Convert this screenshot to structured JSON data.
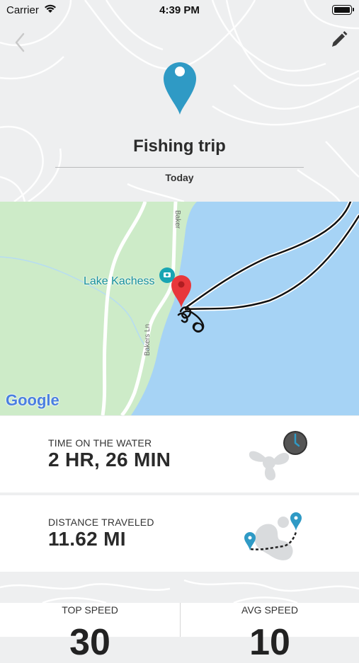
{
  "status_bar": {
    "carrier": "Carrier",
    "time": "4:39 PM"
  },
  "header": {
    "title": "Fishing trip",
    "date": "Today"
  },
  "map": {
    "place_label": "Lake Kachess",
    "road_label_1": "Baker",
    "road_label_2": "Bakers Ln",
    "attribution": "Google",
    "colors": {
      "land": "#cdebc8",
      "water": "#a6d3f5",
      "track": "#111111",
      "pin": "#e8373b"
    }
  },
  "stats": [
    {
      "label": "TIME ON THE WATER",
      "value": "2 HR, 26 MIN",
      "icon": "propeller-clock-icon"
    },
    {
      "label": "DISTANCE TRAVELED",
      "value": "11.62 MI",
      "icon": "route-map-icon"
    }
  ],
  "speeds": {
    "top": {
      "label": "TOP SPEED",
      "value": "30"
    },
    "avg": {
      "label": "AVG SPEED",
      "value": "10"
    }
  },
  "colors": {
    "accent": "#2f9ac5",
    "background": "#eeeff0"
  }
}
